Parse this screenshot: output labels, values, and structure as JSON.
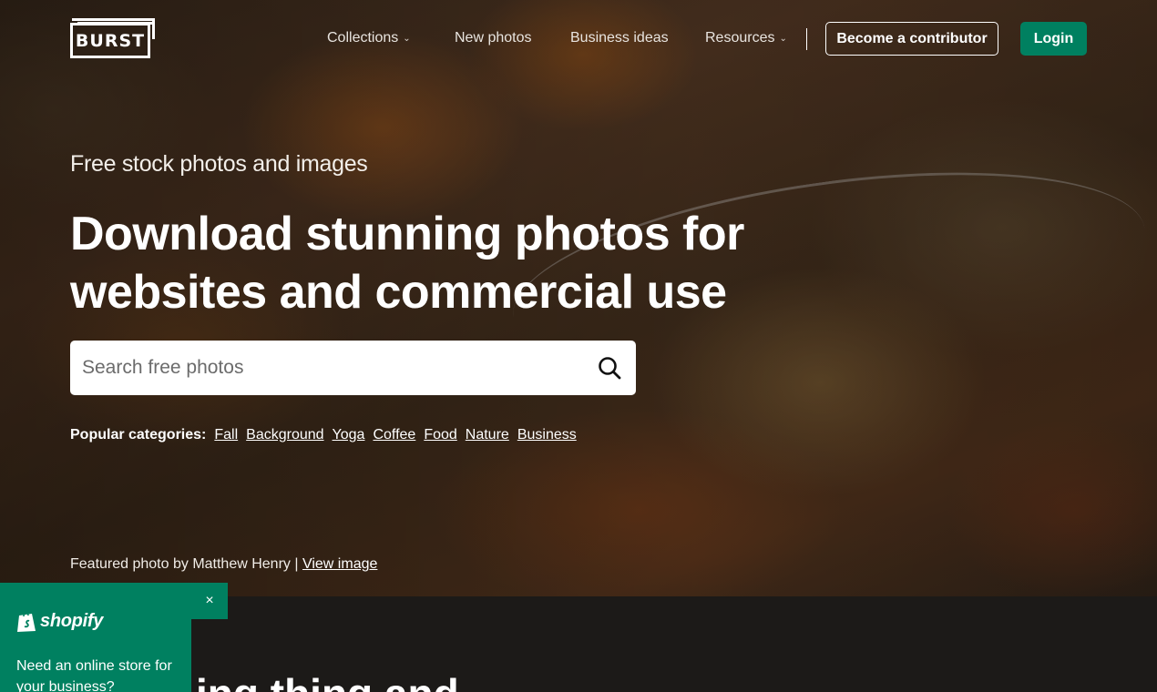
{
  "brand": {
    "logo_text": "BURST"
  },
  "nav": {
    "items": [
      {
        "label": "Collections",
        "has_dropdown": true
      },
      {
        "label": "New photos",
        "has_dropdown": false
      },
      {
        "label": "Business ideas",
        "has_dropdown": false
      },
      {
        "label": "Resources",
        "has_dropdown": true
      }
    ],
    "contributor_button": "Become a contributor",
    "login_button": "Login"
  },
  "hero": {
    "subtitle": "Free stock photos and images",
    "headline": "Download stunning photos for websites and commercial use",
    "search": {
      "placeholder": "Search free photos",
      "value": ""
    },
    "popular": {
      "label": "Popular categories:",
      "categories": [
        "Fall",
        "Background",
        "Yoga",
        "Coffee",
        "Food",
        "Nature",
        "Business"
      ]
    },
    "credit": {
      "text": "Featured photo by Matthew Henry |",
      "link": "View image"
    }
  },
  "section": {
    "heading_partial": "ing thing and"
  },
  "shopify_promo": {
    "brand": "shopify",
    "text": "Need an online store for your business?",
    "close_label": "×"
  },
  "colors": {
    "accent": "#008060",
    "dark_bg": "#1c1a18",
    "text_on_dark": "#ffffff"
  }
}
